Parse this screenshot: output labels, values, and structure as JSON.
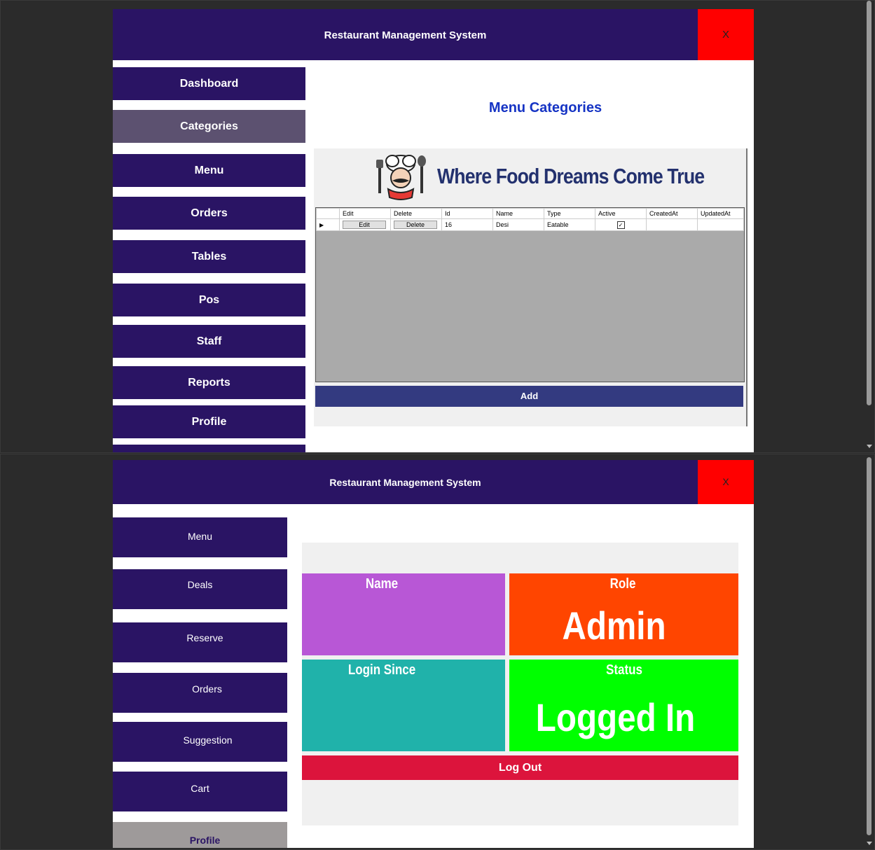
{
  "app": {
    "title": "Restaurant Management System",
    "close_label": "X"
  },
  "screen1": {
    "nav": [
      {
        "label": "Dashboard"
      },
      {
        "label": "Categories",
        "active": true
      },
      {
        "label": "Menu"
      },
      {
        "label": "Orders"
      },
      {
        "label": "Tables"
      },
      {
        "label": "Pos"
      },
      {
        "label": "Staff"
      },
      {
        "label": "Reports"
      },
      {
        "label": "Profile"
      }
    ],
    "heading": "Menu Categories",
    "banner_text": "Where Food Dreams Come True",
    "table": {
      "columns": [
        "Edit",
        "Delete",
        "Id",
        "Name",
        "Type",
        "Active",
        "CreatedAt",
        "UpdatedAt"
      ],
      "rows": [
        {
          "edit": "Edit",
          "delete": "Delete",
          "id": "16",
          "name": "Desi",
          "type": "Eatable",
          "active": true,
          "created_at": "",
          "updated_at": ""
        }
      ]
    },
    "add_label": "Add"
  },
  "screen2": {
    "nav": [
      {
        "label": "Menu"
      },
      {
        "label": "Deals"
      },
      {
        "label": "Reserve"
      },
      {
        "label": "Orders"
      },
      {
        "label": "Suggestion"
      },
      {
        "label": "Cart"
      },
      {
        "label": "Profile",
        "active": true
      }
    ],
    "profile": {
      "name_label": "Name",
      "name_value": "",
      "role_label": "Role",
      "role_value": "Admin",
      "login_label": "Login Since",
      "login_value": "",
      "status_label": "Status",
      "status_value": "Logged In"
    },
    "logout_label": "Log Out"
  },
  "colors": {
    "nav_bg": "#2a1464",
    "close_bg": "#ff0000",
    "heading": "#1533c4",
    "name_tile": "#b857d6",
    "role_tile": "#ff4500",
    "login_tile": "#20b2aa",
    "status_tile": "#00ff00",
    "logout": "#dc143c",
    "add": "#333a80"
  },
  "icons": [
    "chef-mascot-icon",
    "checkbox-checked-icon",
    "row-pointer-icon"
  ]
}
